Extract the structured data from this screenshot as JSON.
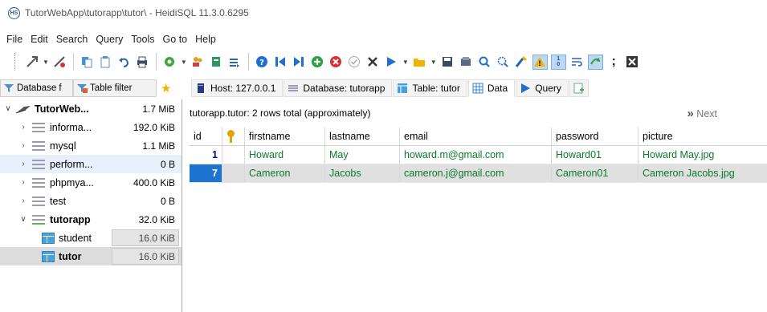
{
  "window": {
    "title": "TutorWebApp\\tutorapp\\tutor\\ - HeidiSQL 11.3.0.6295",
    "app_icon_label": "HS"
  },
  "menu": [
    "File",
    "Edit",
    "Search",
    "Query",
    "Tools",
    "Go to",
    "Help"
  ],
  "left_tabs": [
    {
      "label": "Database f",
      "icon": "database-filter-icon"
    },
    {
      "label": "Table filter",
      "icon": "table-filter-icon"
    }
  ],
  "right_tabs": [
    {
      "label": "Host: 127.0.0.1",
      "icon": "host-icon"
    },
    {
      "label": "Database: tutorapp",
      "icon": "database-icon"
    },
    {
      "label": "Table: tutor",
      "icon": "table-icon"
    },
    {
      "label": "Data",
      "icon": "data-grid-icon",
      "active": true
    },
    {
      "label": "Query",
      "icon": "query-play-icon"
    }
  ],
  "tree": [
    {
      "name": "TutorWeb...",
      "size": "1.7 MiB",
      "level": 0,
      "expanded": true,
      "bold": true,
      "type": "session"
    },
    {
      "name": "informa...",
      "size": "192.0 KiB",
      "level": 1,
      "type": "db"
    },
    {
      "name": "mysql",
      "size": "1.1 MiB",
      "level": 1,
      "type": "db"
    },
    {
      "name": "perform...",
      "size": "0 B",
      "level": 1,
      "type": "db",
      "highlight": true
    },
    {
      "name": "phpmya...",
      "size": "400.0 KiB",
      "level": 1,
      "type": "db"
    },
    {
      "name": "test",
      "size": "0 B",
      "level": 1,
      "type": "db"
    },
    {
      "name": "tutorapp",
      "size": "32.0 KiB",
      "level": 1,
      "type": "db",
      "expanded": true,
      "bold": true
    },
    {
      "name": "student",
      "size": "16.0 KiB",
      "level": 2,
      "type": "table"
    },
    {
      "name": "tutor",
      "size": "16.0 KiB",
      "level": 2,
      "type": "table",
      "selected": true,
      "bold": true
    }
  ],
  "info": {
    "text": "tutorapp.tutor: 2 rows total (approximately)",
    "next_label": "Next"
  },
  "grid": {
    "columns": [
      "id",
      "",
      "firstname",
      "lastname",
      "email",
      "password",
      "picture"
    ],
    "rows": [
      [
        "1",
        "",
        "Howard",
        "May",
        "howard.m@gmail.com",
        "Howard01",
        "Howard May.jpg"
      ],
      [
        "7",
        "",
        "Cameron",
        "Jacobs",
        "cameron.j@gmail.com",
        "Cameron01",
        "Cameron Jacobs.jpg"
      ]
    ]
  },
  "colors": {
    "accent_selected": "#1d74d0",
    "value_green": "#0a7a28",
    "id_blue": "#0000b0"
  }
}
